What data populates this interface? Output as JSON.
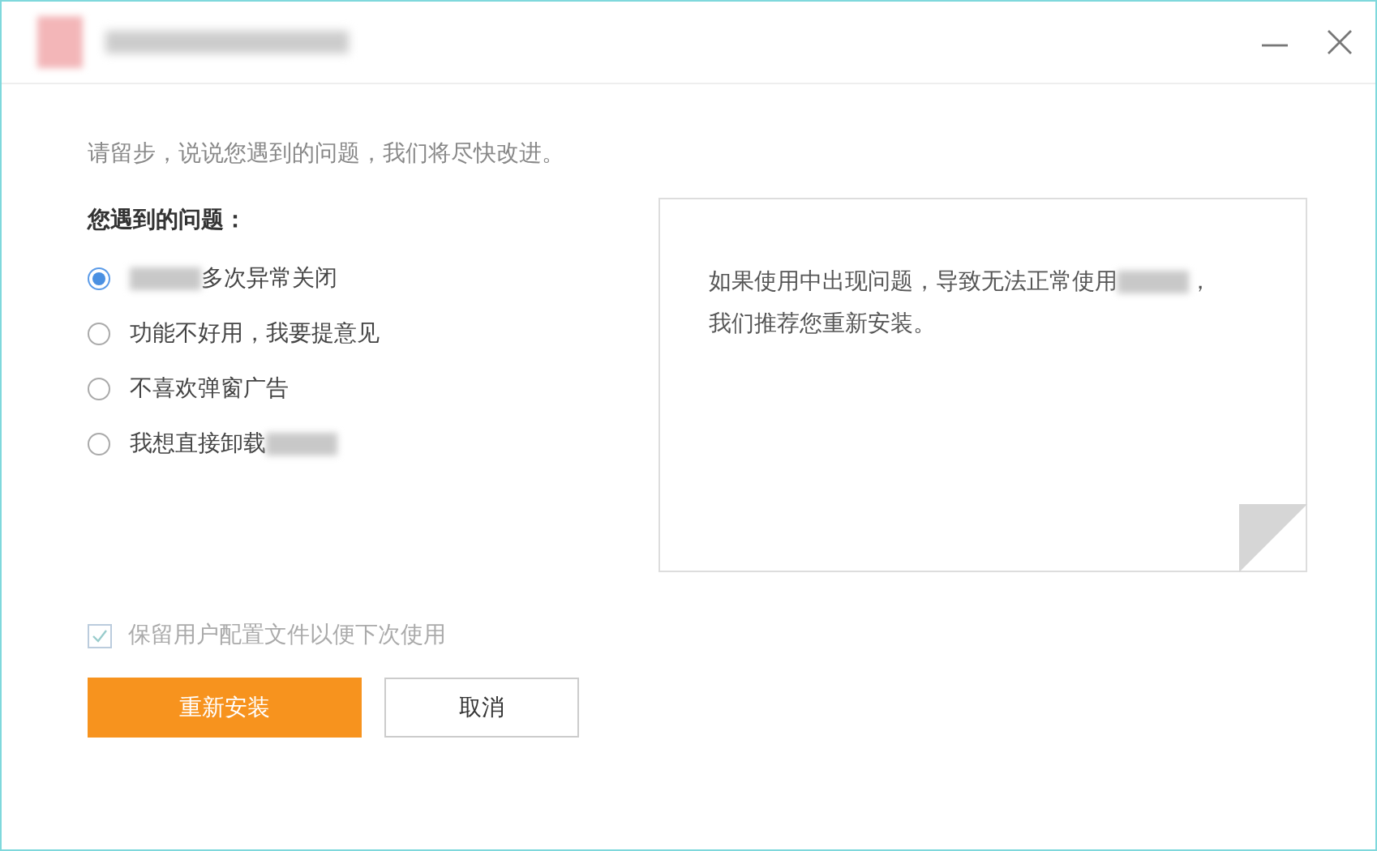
{
  "window": {
    "title_blurred": true
  },
  "prompt": "请留步，说说您遇到的问题，我们将尽快改进。",
  "question": {
    "label": "您遇到的问题："
  },
  "options": [
    {
      "label": "多次异常关闭",
      "selected": true,
      "blurred_before": true
    },
    {
      "label": "功能不好用，我要提意见",
      "selected": false
    },
    {
      "label": "不喜欢弹窗广告",
      "selected": false
    },
    {
      "label": "我想直接卸载",
      "selected": false,
      "blurred_after": true
    }
  ],
  "info_panel": {
    "line_1": "如果使用中出现问题，导致无法正常使用",
    "line_1_end": "，",
    "line_2": "我们推荐您重新安装。"
  },
  "keep_config": {
    "label": "保留用户配置文件以便下次使用",
    "checked": true,
    "disabled": true
  },
  "buttons": [
    {
      "label": "重新安装",
      "kind": "primary"
    },
    {
      "label": "取消",
      "kind": "secondary"
    }
  ]
}
